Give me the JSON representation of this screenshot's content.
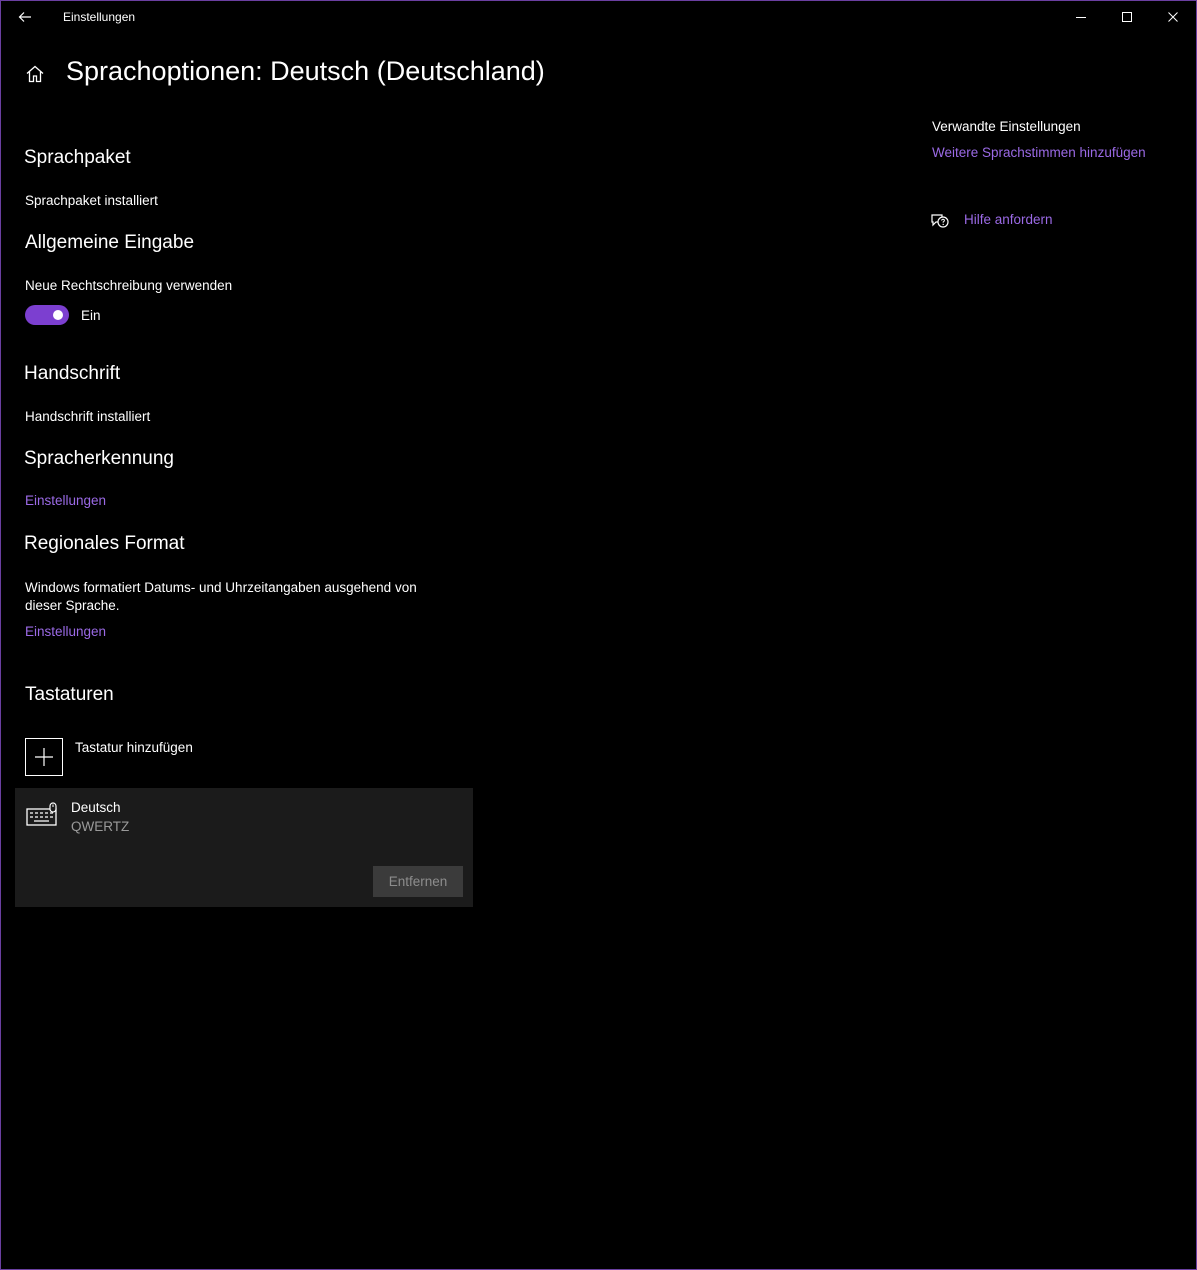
{
  "window": {
    "title": "Einstellungen"
  },
  "page": {
    "title": "Sprachoptionen: Deutsch (Deutschland)"
  },
  "sections": {
    "language_pack": {
      "heading": "Sprachpaket",
      "status": "Sprachpaket installiert"
    },
    "general_input": {
      "heading": "Allgemeine Eingabe",
      "setting_label": "Neue Rechtschreibung verwenden",
      "toggle_state": "Ein",
      "toggle_on": true
    },
    "handwriting": {
      "heading": "Handschrift",
      "status": "Handschrift installiert"
    },
    "speech": {
      "heading": "Spracherkennung",
      "link": "Einstellungen"
    },
    "regional_format": {
      "heading": "Regionales Format",
      "description": "Windows formatiert Datums- und Uhrzeitangaben ausgehend von dieser Sprache.",
      "link": "Einstellungen"
    },
    "keyboards": {
      "heading": "Tastaturen",
      "add_label": "Tastatur hinzufügen",
      "items": [
        {
          "name": "Deutsch",
          "layout": "QWERTZ",
          "remove_label": "Entfernen"
        }
      ]
    }
  },
  "related": {
    "heading": "Verwandte Einstellungen",
    "link": "Weitere Sprachstimmen hinzufügen",
    "help_link": "Hilfe anfordern"
  },
  "colors": {
    "accent": "#9b6ae6",
    "toggle_on": "#7c3fd0",
    "card_bg": "#1b1b1b"
  },
  "icons": [
    "back-arrow-icon",
    "home-icon",
    "minimize-icon",
    "maximize-icon",
    "close-icon",
    "plus-icon",
    "keyboard-icon",
    "help-chat-icon"
  ]
}
